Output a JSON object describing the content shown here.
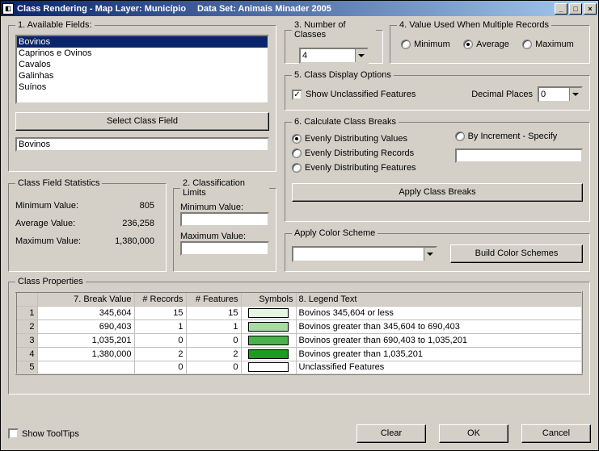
{
  "titlebar": {
    "app": "Class Rendering - Map Layer: Município",
    "dataset_label": "Data Set: Animais Minader 2005"
  },
  "available_fields": {
    "legend": "1. Available Fields:",
    "items": [
      "Bovinos",
      "Caprinos e Ovinos",
      "Cavalos",
      "Galinhas",
      "Suínos"
    ],
    "selected_index": 0,
    "select_btn": "Select Class Field",
    "selected_value": "Bovinos"
  },
  "stats": {
    "legend": "Class Field Statistics",
    "min_label": "Minimum Value:",
    "min_val": "805",
    "avg_label": "Average Value:",
    "avg_val": "236,258",
    "max_label": "Maximum Value:",
    "max_val": "1,380,000"
  },
  "limits": {
    "legend": "2. Classification Limits",
    "min_label": "Minimum Value:",
    "min_val": "",
    "max_label": "Maximum Value:",
    "max_val": ""
  },
  "num_classes": {
    "legend": "3. Number of Classes",
    "value": "4"
  },
  "multi": {
    "legend": "4. Value Used When Multiple Records",
    "options": [
      "Minimum",
      "Average",
      "Maximum"
    ],
    "selected": 1
  },
  "display_opts": {
    "legend": "5. Class Display Options",
    "show_unclassified": "Show Unclassified Features",
    "show_unclassified_checked": true,
    "decimal_label": "Decimal Places",
    "decimal_value": "0"
  },
  "breaks": {
    "legend": "6. Calculate Class Breaks",
    "options": [
      "Evenly Distributing Values",
      "Evenly Distributing Records",
      "Evenly Distributing Features"
    ],
    "selected": 0,
    "by_increment": "By Increment - Specify",
    "by_increment_val": "",
    "apply_btn": "Apply Class Breaks"
  },
  "color_scheme": {
    "legend": "Apply Color Scheme",
    "value": "",
    "build_btn": "Build Color Schemes"
  },
  "props": {
    "legend": "Class Properties",
    "headers": [
      "7. Break Value",
      "# Records",
      "# Features",
      "Symbols",
      "8. Legend Text"
    ],
    "rows": [
      {
        "n": "1",
        "break": "345,604",
        "rec": "15",
        "feat": "15",
        "color": "#e6f5e0",
        "legend": "Bovinos 345,604 or less"
      },
      {
        "n": "2",
        "break": "690,403",
        "rec": "1",
        "feat": "1",
        "color": "#a4dca4",
        "legend": "Bovinos greater than 345,604 to 690,403"
      },
      {
        "n": "3",
        "break": "1,035,201",
        "rec": "0",
        "feat": "0",
        "color": "#4bb24b",
        "legend": "Bovinos greater than 690,403 to 1,035,201"
      },
      {
        "n": "4",
        "break": "1,380,000",
        "rec": "2",
        "feat": "2",
        "color": "#1b9e1b",
        "legend": "Bovinos greater than 1,035,201"
      },
      {
        "n": "5",
        "break": "",
        "rec": "0",
        "feat": "0",
        "color": "#ffffff",
        "legend": "Unclassified Features"
      }
    ]
  },
  "footer": {
    "tooltips": "Show ToolTips",
    "clear": "Clear",
    "ok": "OK",
    "cancel": "Cancel"
  }
}
